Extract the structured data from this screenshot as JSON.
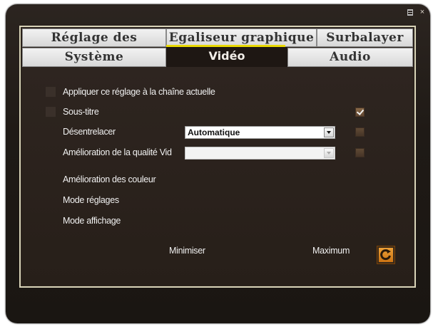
{
  "window": {
    "titlebar": {
      "menu_icon": "menu-icon",
      "close_label": "×"
    }
  },
  "tabs_row1": [
    {
      "label": "Réglage des couleurs"
    },
    {
      "label": "Egaliseur graphique"
    },
    {
      "label": "Surbalayer"
    }
  ],
  "tabs_row2": [
    {
      "label": "Système"
    },
    {
      "label": "Vidéo",
      "active": true
    },
    {
      "label": "Audio"
    }
  ],
  "video": {
    "apply_channel_label": "Appliquer ce réglage à la chaîne actuelle",
    "subtitle_label": "Sous-titre",
    "subtitle_checked": true,
    "deinterlace_label": "Désentrelacer",
    "deinterlace_value": "Automatique",
    "deinterlace_checked": false,
    "quality_label": "Amélioration de la qualité Vid",
    "quality_value": "",
    "quality_checked": false,
    "color_enhance_label": "Amélioration des couleur",
    "mode_settings_label": "Mode réglages",
    "mode_display_label": "Mode affichage",
    "min_label": "Minimiser",
    "max_label": "Maximum",
    "reset_icon": "refresh-icon"
  },
  "colors": {
    "accent_yellow": "#e8d800",
    "reset_orange": "#e08a20",
    "panel_border": "#d9d4b8"
  }
}
